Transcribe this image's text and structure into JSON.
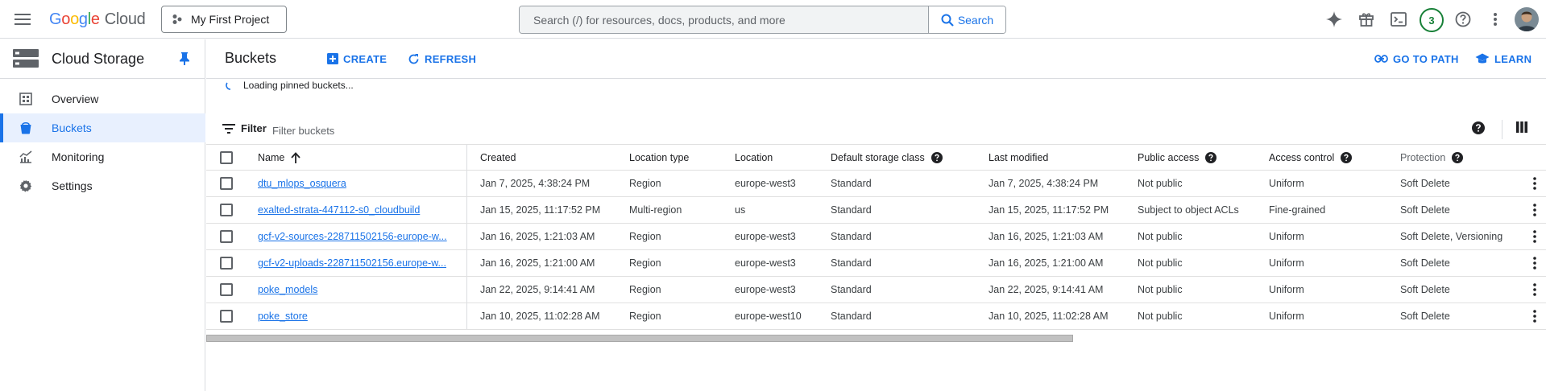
{
  "topbar": {
    "logo": {
      "g": "G",
      "o1": "o",
      "o2": "o",
      "g2": "g",
      "l": "l",
      "e": "e",
      "cloud": "Cloud"
    },
    "project_label": "My First Project",
    "search_placeholder": "Search (/) for resources, docs, products, and more",
    "search_button_label": "Search",
    "notification_count": "3",
    "icons": [
      "menu-icon",
      "project-icon",
      "search-icon",
      "gemini-icon",
      "gift-icon",
      "terminal-icon",
      "help-icon",
      "more-vert-icon",
      "avatar"
    ]
  },
  "sidebar": {
    "title": "Cloud Storage",
    "items": [
      {
        "label": "Overview",
        "icon": "dashboard-icon",
        "active": false
      },
      {
        "label": "Buckets",
        "icon": "bucket-icon",
        "active": true
      },
      {
        "label": "Monitoring",
        "icon": "monitoring-icon",
        "active": false
      },
      {
        "label": "Settings",
        "icon": "settings-icon",
        "active": false
      }
    ]
  },
  "header": {
    "title": "Buckets",
    "create_label": "CREATE",
    "refresh_label": "REFRESH",
    "go_to_path_label": "GO TO PATH",
    "learn_label": "LEARN"
  },
  "loading_text": "Loading pinned buckets...",
  "filter": {
    "label": "Filter",
    "placeholder": "Filter buckets"
  },
  "table": {
    "columns": {
      "name": "Name",
      "created": "Created",
      "location_type": "Location type",
      "location": "Location",
      "storage_class": "Default storage class",
      "last_modified": "Last modified",
      "public_access": "Public access",
      "access_control": "Access control",
      "protection": "Protection"
    },
    "rows": [
      {
        "name": "dtu_mlops_osquera",
        "created": "Jan 7, 2025, 4:38:24 PM",
        "location_type": "Region",
        "location": "europe-west3",
        "storage_class": "Standard",
        "last_modified": "Jan 7, 2025, 4:38:24 PM",
        "public_access": "Not public",
        "access_control": "Uniform",
        "protection": "Soft Delete"
      },
      {
        "name": "exalted-strata-447112-s0_cloudbuild",
        "created": "Jan 15, 2025, 11:17:52 PM",
        "location_type": "Multi-region",
        "location": "us",
        "storage_class": "Standard",
        "last_modified": "Jan 15, 2025, 11:17:52 PM",
        "public_access": "Subject to object ACLs",
        "access_control": "Fine-grained",
        "protection": "Soft Delete"
      },
      {
        "name": "gcf-v2-sources-228711502156-europe-w...",
        "created": "Jan 16, 2025, 1:21:03 AM",
        "location_type": "Region",
        "location": "europe-west3",
        "storage_class": "Standard",
        "last_modified": "Jan 16, 2025, 1:21:03 AM",
        "public_access": "Not public",
        "access_control": "Uniform",
        "protection": "Soft Delete, Versioning"
      },
      {
        "name": "gcf-v2-uploads-228711502156.europe-w...",
        "created": "Jan 16, 2025, 1:21:00 AM",
        "location_type": "Region",
        "location": "europe-west3",
        "storage_class": "Standard",
        "last_modified": "Jan 16, 2025, 1:21:00 AM",
        "public_access": "Not public",
        "access_control": "Uniform",
        "protection": "Soft Delete"
      },
      {
        "name": "poke_models",
        "created": "Jan 22, 2025, 9:14:41 AM",
        "location_type": "Region",
        "location": "europe-west3",
        "storage_class": "Standard",
        "last_modified": "Jan 22, 2025, 9:14:41 AM",
        "public_access": "Not public",
        "access_control": "Uniform",
        "protection": "Soft Delete"
      },
      {
        "name": "poke_store",
        "created": "Jan 10, 2025, 11:02:28 AM",
        "location_type": "Region",
        "location": "europe-west10",
        "storage_class": "Standard",
        "last_modified": "Jan 10, 2025, 11:02:28 AM",
        "public_access": "Not public",
        "access_control": "Uniform",
        "protection": "Soft Delete"
      }
    ]
  },
  "colors": {
    "accent": "#1a73e8",
    "active_nav_bg": "#e8f0fe",
    "badge_green": "#188038",
    "border": "#dadce0"
  }
}
